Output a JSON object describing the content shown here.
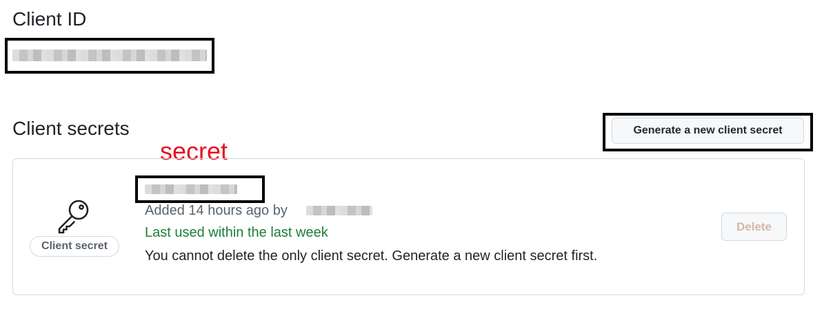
{
  "client_id": {
    "heading": "Client ID"
  },
  "client_secrets": {
    "heading": "Client secrets",
    "generate_button_label": "Generate a new client secret",
    "annotation_label": "secret",
    "secret": {
      "badge_label": "Client secret",
      "icon": "key-icon",
      "added_prefix": "Added 14 hours ago by",
      "last_used": "Last used within the last week",
      "warning": "You cannot delete the only client secret. Generate a new client secret first.",
      "delete_label": "Delete"
    }
  },
  "colors": {
    "annotation_red": "#e5111d",
    "last_used_green": "#1a7f37",
    "delete_disabled_text": "#d7b6a6"
  }
}
